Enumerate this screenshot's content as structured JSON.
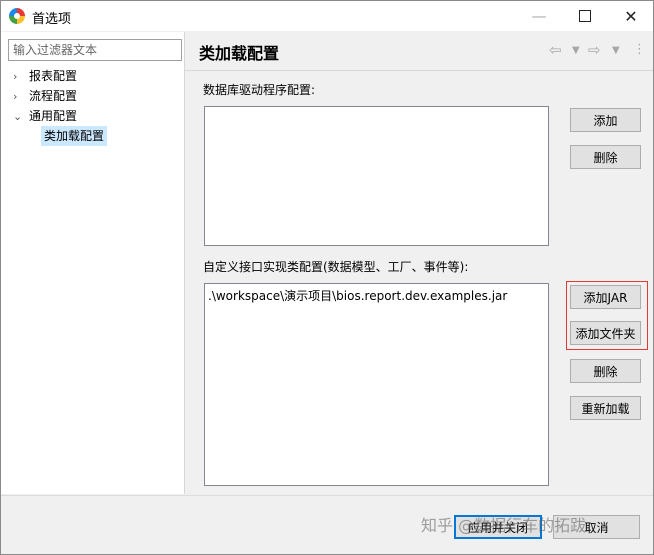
{
  "window": {
    "title": "首选项"
  },
  "sidebar": {
    "filter_placeholder": "输入过滤器文本",
    "items": [
      {
        "label": "报表配置",
        "expander": "›"
      },
      {
        "label": "流程配置",
        "expander": "›"
      },
      {
        "label": "通用配置",
        "expander": "⌄"
      },
      {
        "label": "类加载配置",
        "expander": ""
      }
    ]
  },
  "page": {
    "title": "类加载配置",
    "driver_section": {
      "label": "数据库驱动程序配置:",
      "entries": [],
      "buttons": {
        "add": "添加",
        "remove": "删除"
      }
    },
    "impl_section": {
      "label": "自定义接口实现类配置(数据模型、工厂、事件等):",
      "entries": [
        ".\\workspace\\演示项目\\bios.report.dev.examples.jar"
      ],
      "buttons": {
        "add_jar": "添加JAR",
        "add_folder": "添加文件夹",
        "remove": "删除",
        "reload": "重新加载"
      }
    }
  },
  "footer": {
    "apply_label": "应用并关闭",
    "cancel_label": "取消",
    "watermark": "知乎 @数据行车的拓跋"
  },
  "colors": {
    "accent": "#0078d7",
    "highlight": "#e53935",
    "selection": "#cce8ff"
  },
  "icons": {
    "app": "app-logo-icon",
    "minimize": "minimize-icon",
    "maximize": "maximize-icon",
    "close": "close-icon",
    "back": "back-arrow-icon",
    "forward": "forward-arrow-icon",
    "menu": "view-menu-icon"
  }
}
